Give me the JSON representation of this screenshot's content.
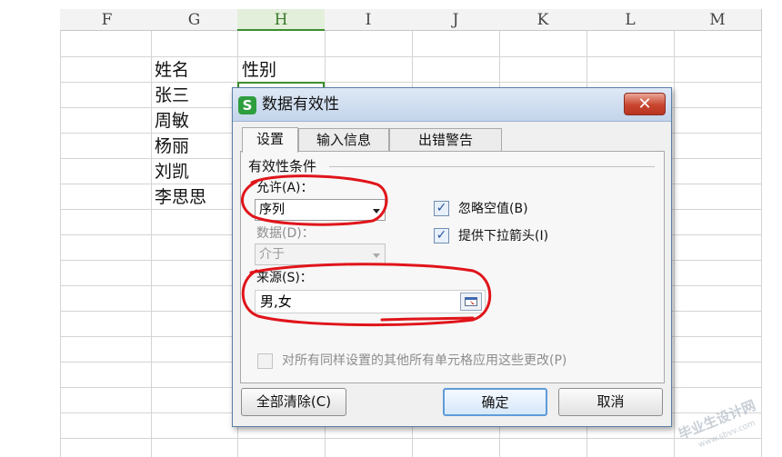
{
  "sheet": {
    "columns": [
      "F",
      "G",
      "H",
      "I",
      "J",
      "K",
      "L",
      "M"
    ],
    "selected_column": "H",
    "header_row": {
      "name": "姓名",
      "gender": "性别"
    },
    "names": [
      "张三",
      "周敏",
      "杨丽",
      "刘凯",
      "李思思"
    ]
  },
  "dialog": {
    "app_icon_letter": "S",
    "title": "数据有效性",
    "close_glyph": "✕",
    "tabs": [
      {
        "label": "设置",
        "active": true
      },
      {
        "label": "输入信息",
        "active": false
      },
      {
        "label": "出错警告",
        "active": false
      }
    ],
    "group_label": "有效性条件",
    "allow_label": "允许(A)：",
    "allow_value": "序列",
    "data_label": "数据(D)：",
    "data_value": "介于",
    "ignore_blank": {
      "label": "忽略空值(B)",
      "checked": true
    },
    "dropdown_arrow": {
      "label": "提供下拉箭头(I)",
      "checked": true
    },
    "source_label": "来源(S)：",
    "source_value": "男,女",
    "apply_all": {
      "label": "对所有同样设置的其他所有单元格应用这些更改(P)",
      "checked": false
    },
    "buttons": {
      "clear_all": "全部清除(C)",
      "ok": "确定",
      "cancel": "取消"
    },
    "check_glyph": "✓"
  },
  "colors": {
    "accent_green": "#3b8f2e",
    "annotation_red": "#e0141a",
    "close_red": "#c9452f"
  },
  "watermark": {
    "text": "毕业生设计网",
    "url": "www.sbvv.com"
  }
}
